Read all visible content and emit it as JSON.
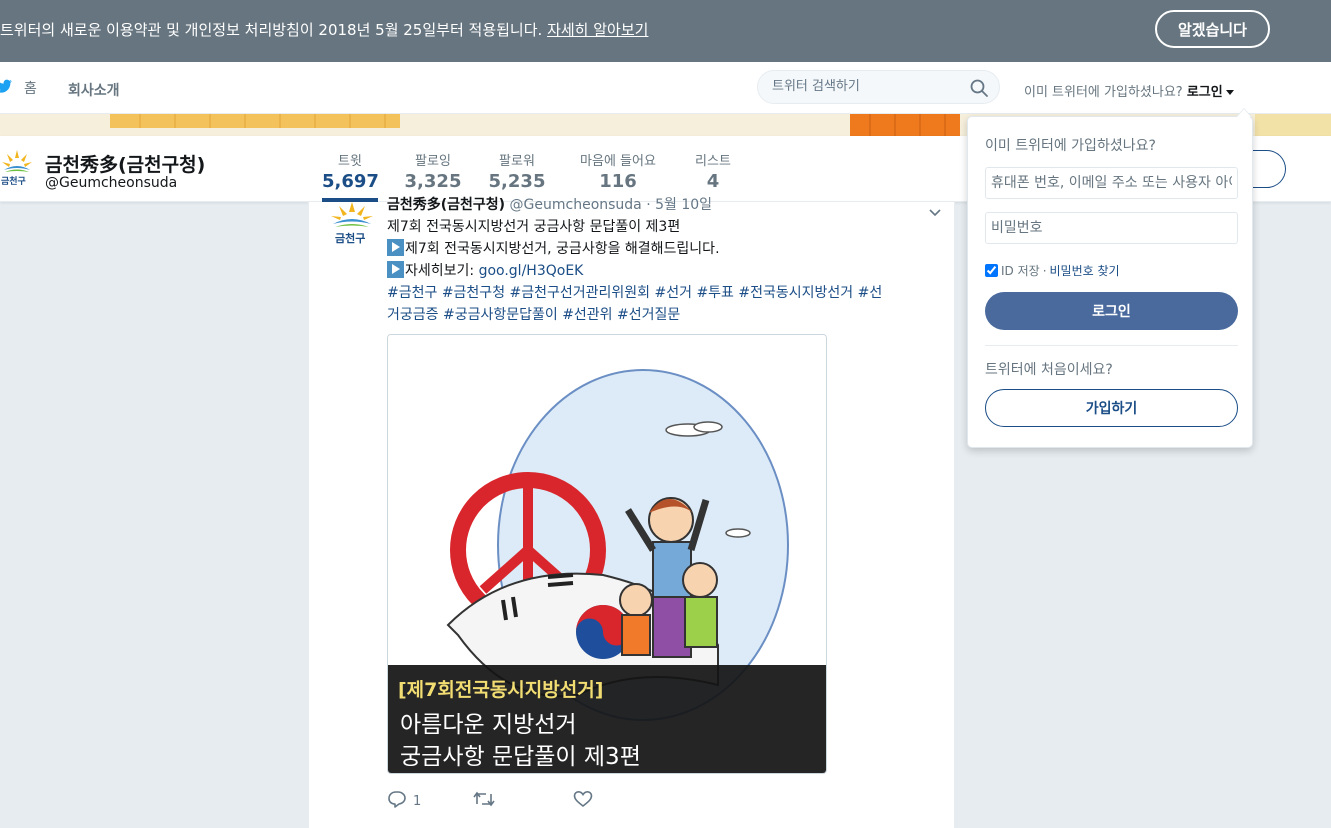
{
  "banner": {
    "text": "트위터의 새로운 이용약관 및 개인정보 처리방침이 2018년 5월 25일부터 적용됩니다.",
    "link": "자세히 알아보기",
    "dismiss": "알겠습니다"
  },
  "nav": {
    "home": "홈",
    "about": "회사소개",
    "search_placeholder": "트위터 검색하기",
    "login_question": "이미 트위터에 가입하셨나요?",
    "login_link": "로그인"
  },
  "profile": {
    "name": "금천秀多(금천구청)",
    "handle": "@Geumcheonsuda",
    "avatar_text": "금천구",
    "stats": [
      {
        "label": "트윗",
        "value": "5,697"
      },
      {
        "label": "팔로잉",
        "value": "3,325"
      },
      {
        "label": "팔로워",
        "value": "5,235"
      },
      {
        "label": "마음에 들어요",
        "value": "116"
      },
      {
        "label": "리스트",
        "value": "4"
      }
    ]
  },
  "tweet": {
    "author": "금천秀多(금천구청)",
    "handle": "@Geumcheonsuda",
    "date": "5월 10일",
    "line1": "제7회 전국동시지방선거 궁금사항 문답풀이 제3편",
    "line2": "제7회 전국동시지방선거, 궁금사항을 해결해드립니다.",
    "line3_prefix": "자세히보기: ",
    "line3_link": "goo.gl/H3QoEK",
    "hashtags_line1": "#금천구 #금천구청 #금천구선거관리위원회 #선거 #투표 #전국동시지방선거 #선",
    "hashtags_line2": "거궁금증 #궁금사항문답풀이 #선관위 #선거질문",
    "avatar_text": "금천구",
    "media": {
      "caption1": "[제7회전국동시지방선거]",
      "caption2": "아름다운 지방선거",
      "caption3": "궁금사항 문답풀이 제3편"
    },
    "reply_count": "1"
  },
  "login_dropdown": {
    "question": "이미 트위터에 가입하셨나요?",
    "username_placeholder": "휴대폰 번호, 이메일 주소 또는 사용자 아이디",
    "password_placeholder": "비밀번호",
    "remember": "ID 저장",
    "separator": "·",
    "forgot": "비밀번호 찾기",
    "login_button": "로그인",
    "new_question": "트위터에 처음이세요?",
    "signup_button": "가입하기"
  },
  "colors": {
    "banner_bg": "#66757f",
    "accent": "#1b4d86",
    "login_button": "#4a6a9e",
    "page_bg": "#e6ecf0"
  },
  "icons": [
    "twitter-bird-icon",
    "search-icon",
    "caret-down-icon",
    "chevron-down-icon",
    "reply-icon",
    "retweet-icon",
    "heart-icon",
    "play-icon"
  ]
}
